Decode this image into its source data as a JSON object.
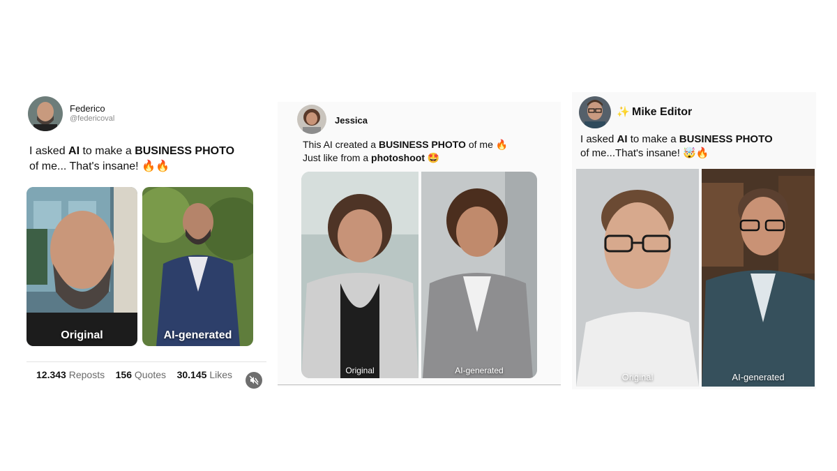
{
  "posts": [
    {
      "name": "Federico",
      "handle": "@federicoval",
      "text_a": "I asked ",
      "text_b": "AI",
      "text_c": " to make a ",
      "text_d": "BUSINESS PHOTO",
      "text_e": "of me... That's insane! ",
      "emoji": "🔥🔥",
      "label_left": "Original",
      "label_right": "AI-generated",
      "stats": {
        "reposts_value": "12.343",
        "reposts_label": "Reposts",
        "quotes_value": "156",
        "quotes_label": "Quotes",
        "likes_value": "30.145",
        "likes_label": "Likes"
      },
      "mute_icon": "speaker-muted-icon"
    },
    {
      "name": "Jessica",
      "line1_a": "This AI created a ",
      "line1_b": "BUSINESS PHOTO",
      "line1_c": " of me ",
      "line1_emoji": "🔥",
      "line2_a": "Just like from a ",
      "line2_b": "photoshoot",
      "line2_emoji": "🤩",
      "label_left": "Original",
      "label_right": "AI-generated"
    },
    {
      "sparkle": "✨",
      "name": "Mike Editor",
      "line1_a": "I asked ",
      "line1_b": "AI",
      "line1_c": " to make a ",
      "line1_d": "BUSINESS PHOTO",
      "line2_a": "of me...That's insane! ",
      "line2_emoji": "🤯🔥",
      "label_left": "Original",
      "label_right": "AI-generated"
    }
  ],
  "colors": {
    "fire": "#ff5a1f",
    "muted_text": "#8a8a8a",
    "photo_label": "#ffffff"
  }
}
